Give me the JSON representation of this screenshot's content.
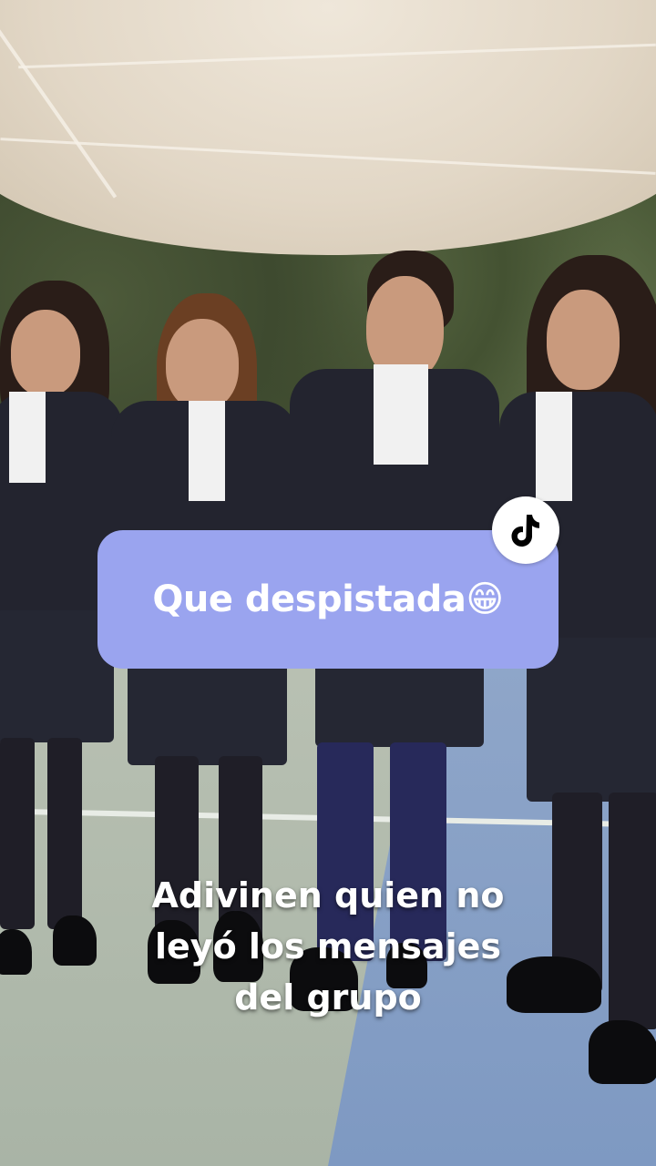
{
  "sticker": {
    "question": "Que despistada",
    "emoji": "😁",
    "badge_icon": "tiktok-logo-icon"
  },
  "caption": {
    "line1": "Adivinen quien no",
    "line2": "leyó los mensajes",
    "line3": "del grupo"
  },
  "colors": {
    "bubble": "#9aa4ef",
    "caption_text": "#ffffff"
  }
}
